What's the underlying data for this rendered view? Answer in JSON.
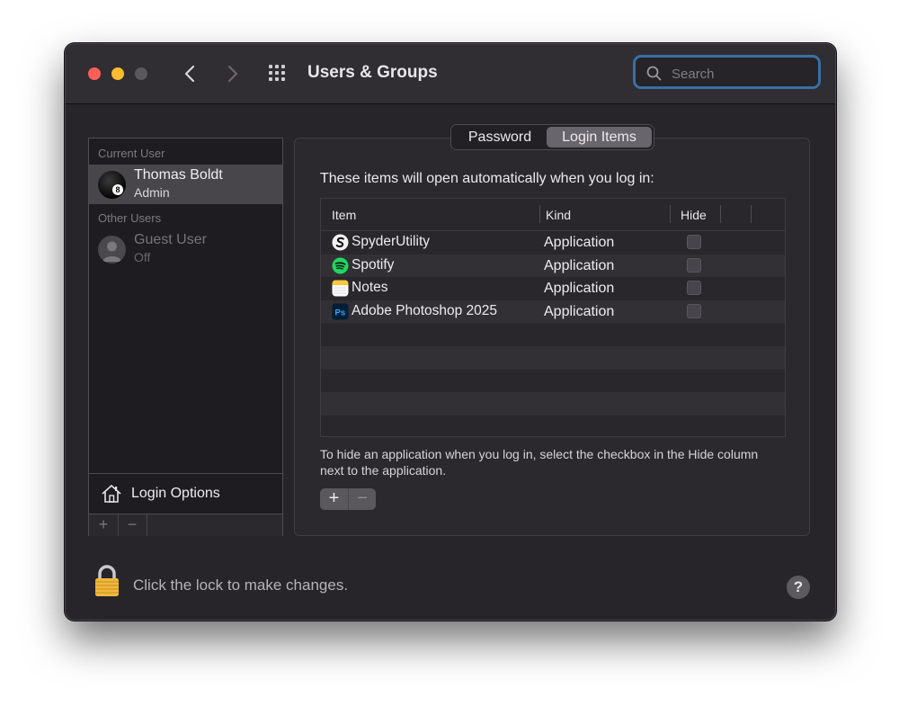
{
  "window": {
    "title": "Users & Groups",
    "search_placeholder": "Search",
    "search_value": ""
  },
  "sidebar": {
    "current_user_label": "Current User",
    "other_users_label": "Other Users",
    "current_user": {
      "name": "Thomas Boldt",
      "role": "Admin",
      "avatar": "eight-ball"
    },
    "other_users": [
      {
        "name": "Guest User",
        "role": "Off"
      }
    ],
    "login_options_label": "Login Options",
    "add_label": "+",
    "remove_label": "−"
  },
  "tabs": [
    {
      "label": "Password",
      "selected": false
    },
    {
      "label": "Login Items",
      "selected": true
    }
  ],
  "login_items": {
    "intro": "These items will open automatically when you log in:",
    "columns": [
      "Item",
      "Kind",
      "Hide"
    ],
    "rows": [
      {
        "name": "SpyderUtility",
        "kind": "Application",
        "hide": false,
        "icon": "spyder-icon"
      },
      {
        "name": "Spotify",
        "kind": "Application",
        "hide": false,
        "icon": "spotify-icon"
      },
      {
        "name": "Notes",
        "kind": "Application",
        "hide": false,
        "icon": "notes-icon"
      },
      {
        "name": "Adobe Photoshop 2025",
        "kind": "Application",
        "hide": false,
        "icon": "photoshop-icon"
      }
    ],
    "hint": "To hide an application when you log in, select the checkbox in the Hide column next to the application.",
    "add_label": "+",
    "remove_label": "−",
    "ps_badge": "Ps"
  },
  "footer": {
    "lock_text": "Click the lock to make changes.",
    "help_label": "?"
  },
  "colors": {
    "accent": "#3a6fa4",
    "spotify": "#1ed760",
    "photoshop": "#31a8ff",
    "lock": "#f0b83d"
  }
}
